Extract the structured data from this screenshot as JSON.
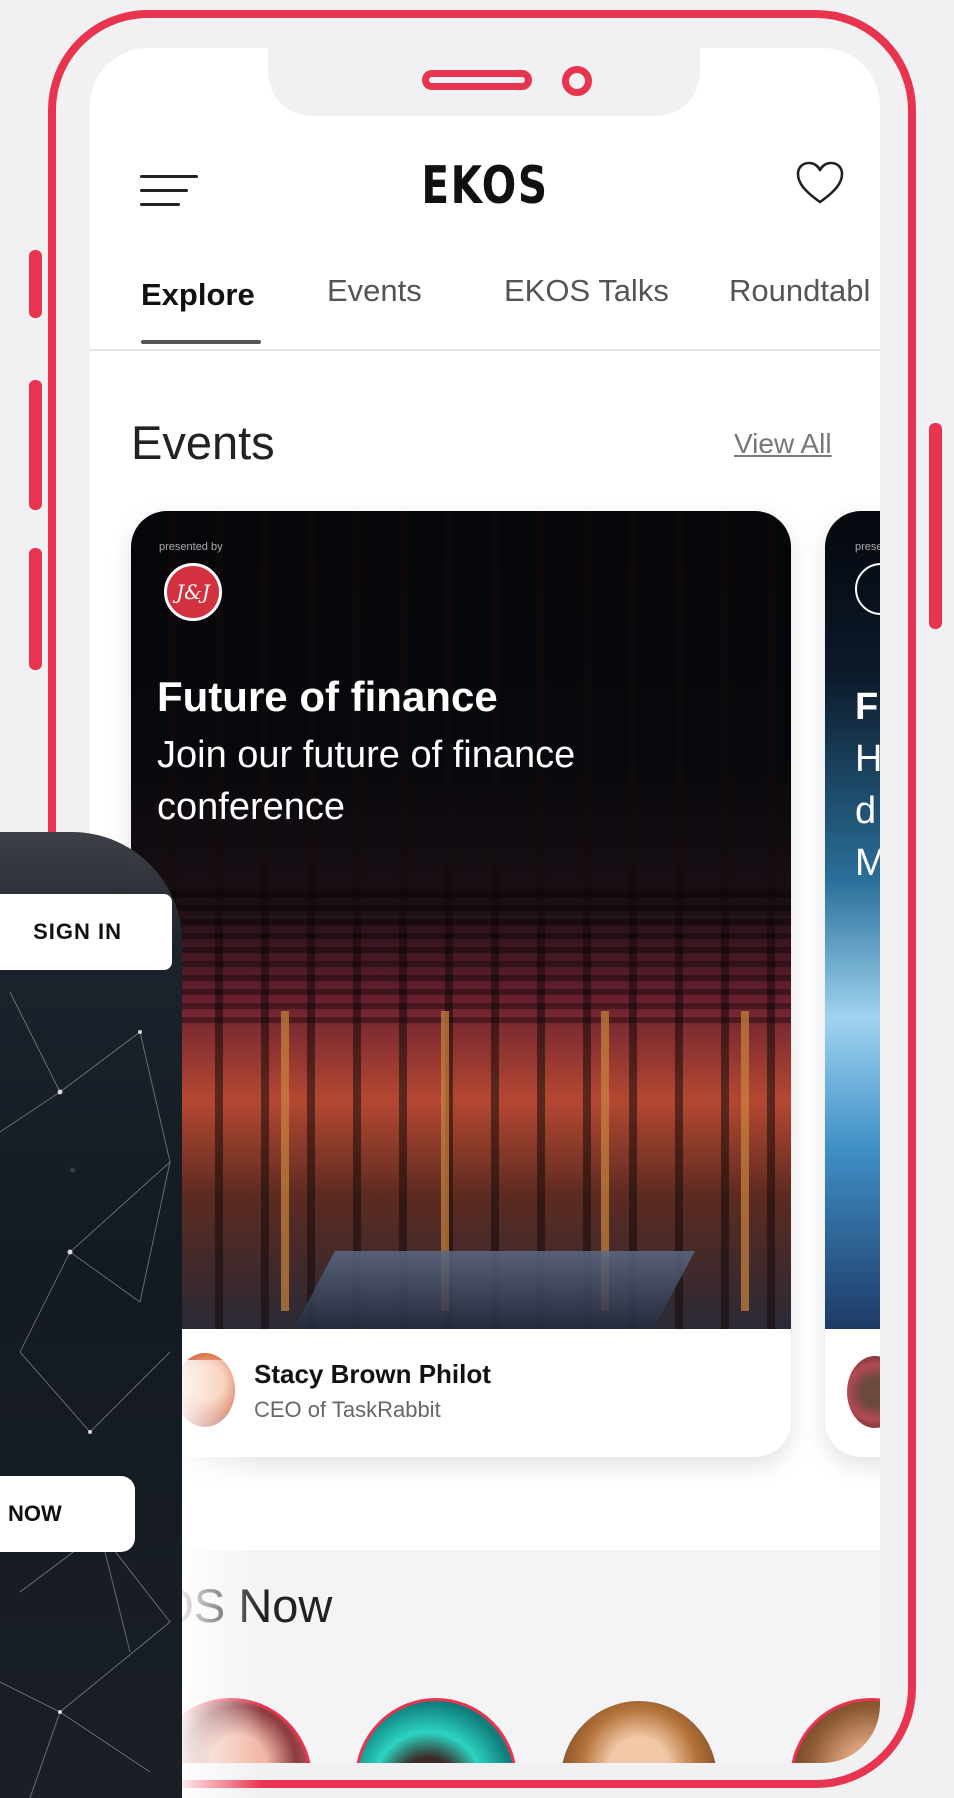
{
  "header": {
    "title": "EKOS"
  },
  "tabs": [
    {
      "label": "Explore"
    },
    {
      "label": "Events"
    },
    {
      "label": "EKOS Talks"
    },
    {
      "label": "Roundtabl"
    }
  ],
  "events_section": {
    "title": "Events",
    "view_all": "View All",
    "cards": [
      {
        "presented_by": "presented by",
        "sponsor_logo_text": "J&J",
        "title": "Future of finance",
        "description": "Join our future of finance conference",
        "speaker_name": "Stacy Brown Philot",
        "speaker_role": "CEO of TaskRabbit"
      },
      {
        "presented_by": "prese",
        "text_lines": [
          "F",
          "H",
          "d",
          "M"
        ]
      }
    ]
  },
  "now_section": {
    "title": "KOS Now"
  },
  "signin_panel": {
    "sign_in": "SIGN IN",
    "now_button": "NOW"
  },
  "colors": {
    "accent": "#e8344e",
    "text": "#111111",
    "muted": "#777777"
  },
  "icons": [
    "hamburger-menu-icon",
    "heart-icon"
  ]
}
